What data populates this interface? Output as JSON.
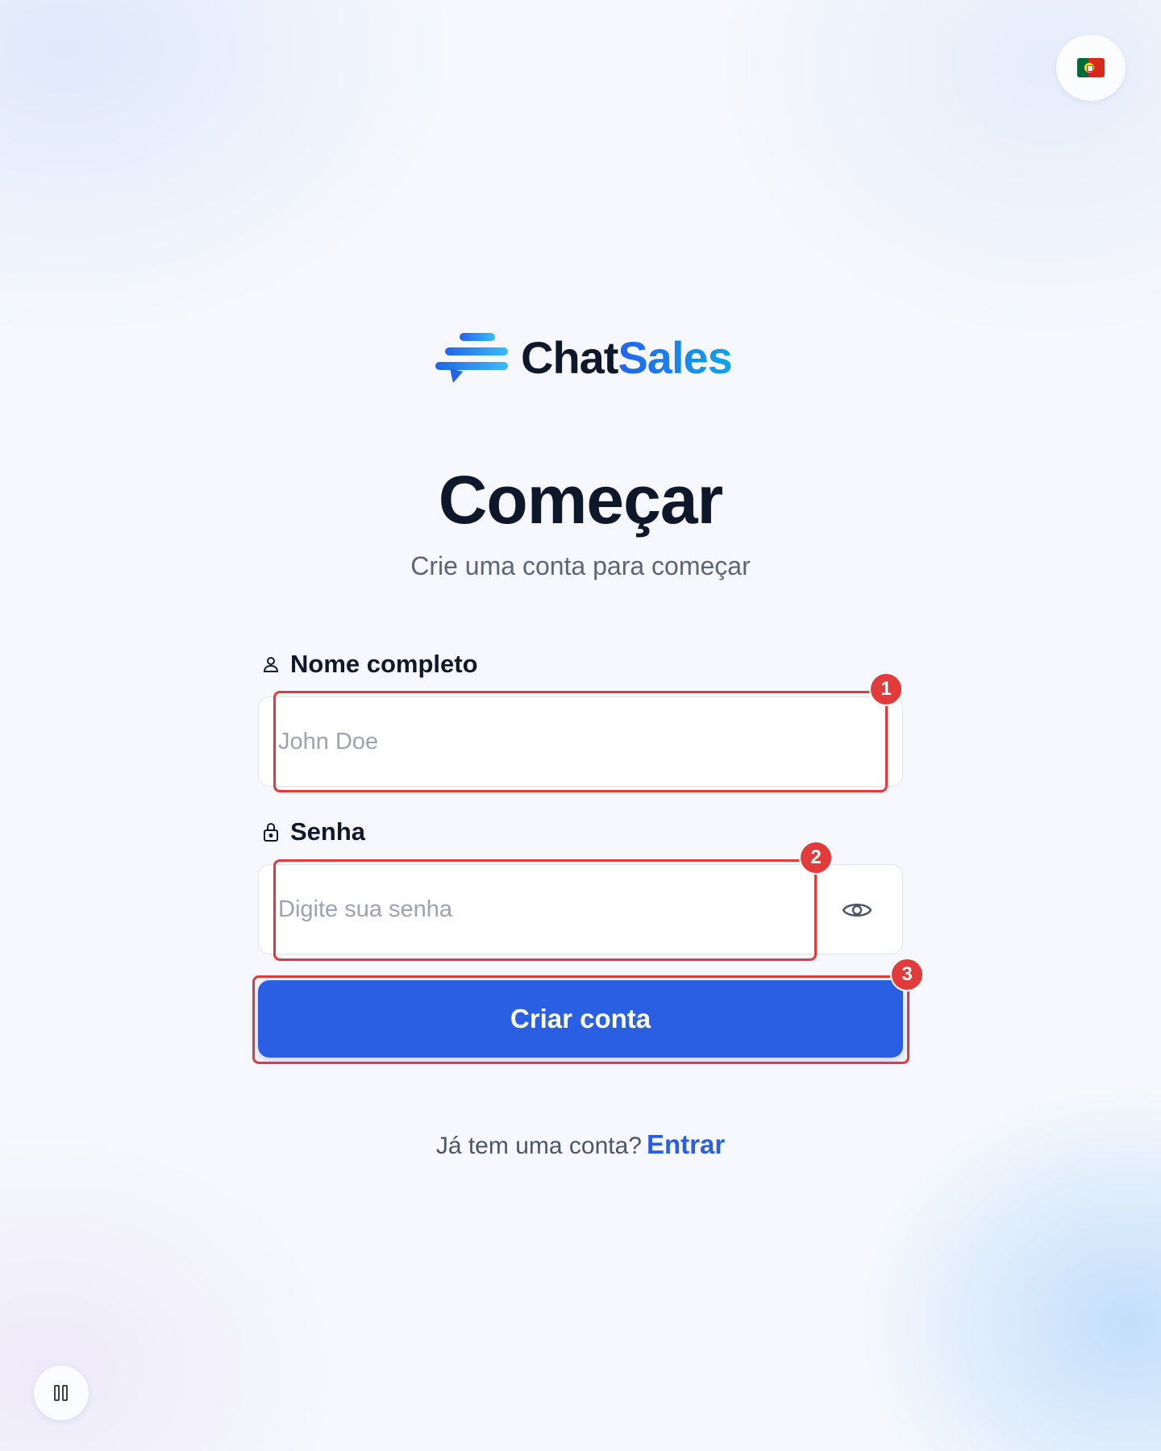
{
  "language": {
    "flag_icon": "portugal-flag-icon",
    "label": "Português"
  },
  "brand": {
    "part1": "Chat",
    "part2": "Sales",
    "logo_icon": "chat-bubble-lines-icon"
  },
  "page": {
    "title": "Começar",
    "subtitle": "Crie uma conta para começar"
  },
  "form": {
    "name": {
      "label": "Nome completo",
      "placeholder": "John Doe",
      "value": "",
      "icon": "user-icon"
    },
    "password": {
      "label": "Senha",
      "placeholder": "Digite sua senha",
      "value": "",
      "icon": "lock-icon",
      "toggle_icon": "eye-icon"
    },
    "submit_label": "Criar conta"
  },
  "footer": {
    "prompt": "Já tem uma conta?",
    "link": "Entrar"
  },
  "annotations": [
    "1",
    "2",
    "3"
  ],
  "colors": {
    "accent": "#2b5fe3",
    "marker": "#e23b3b",
    "heading": "#0f172a"
  }
}
